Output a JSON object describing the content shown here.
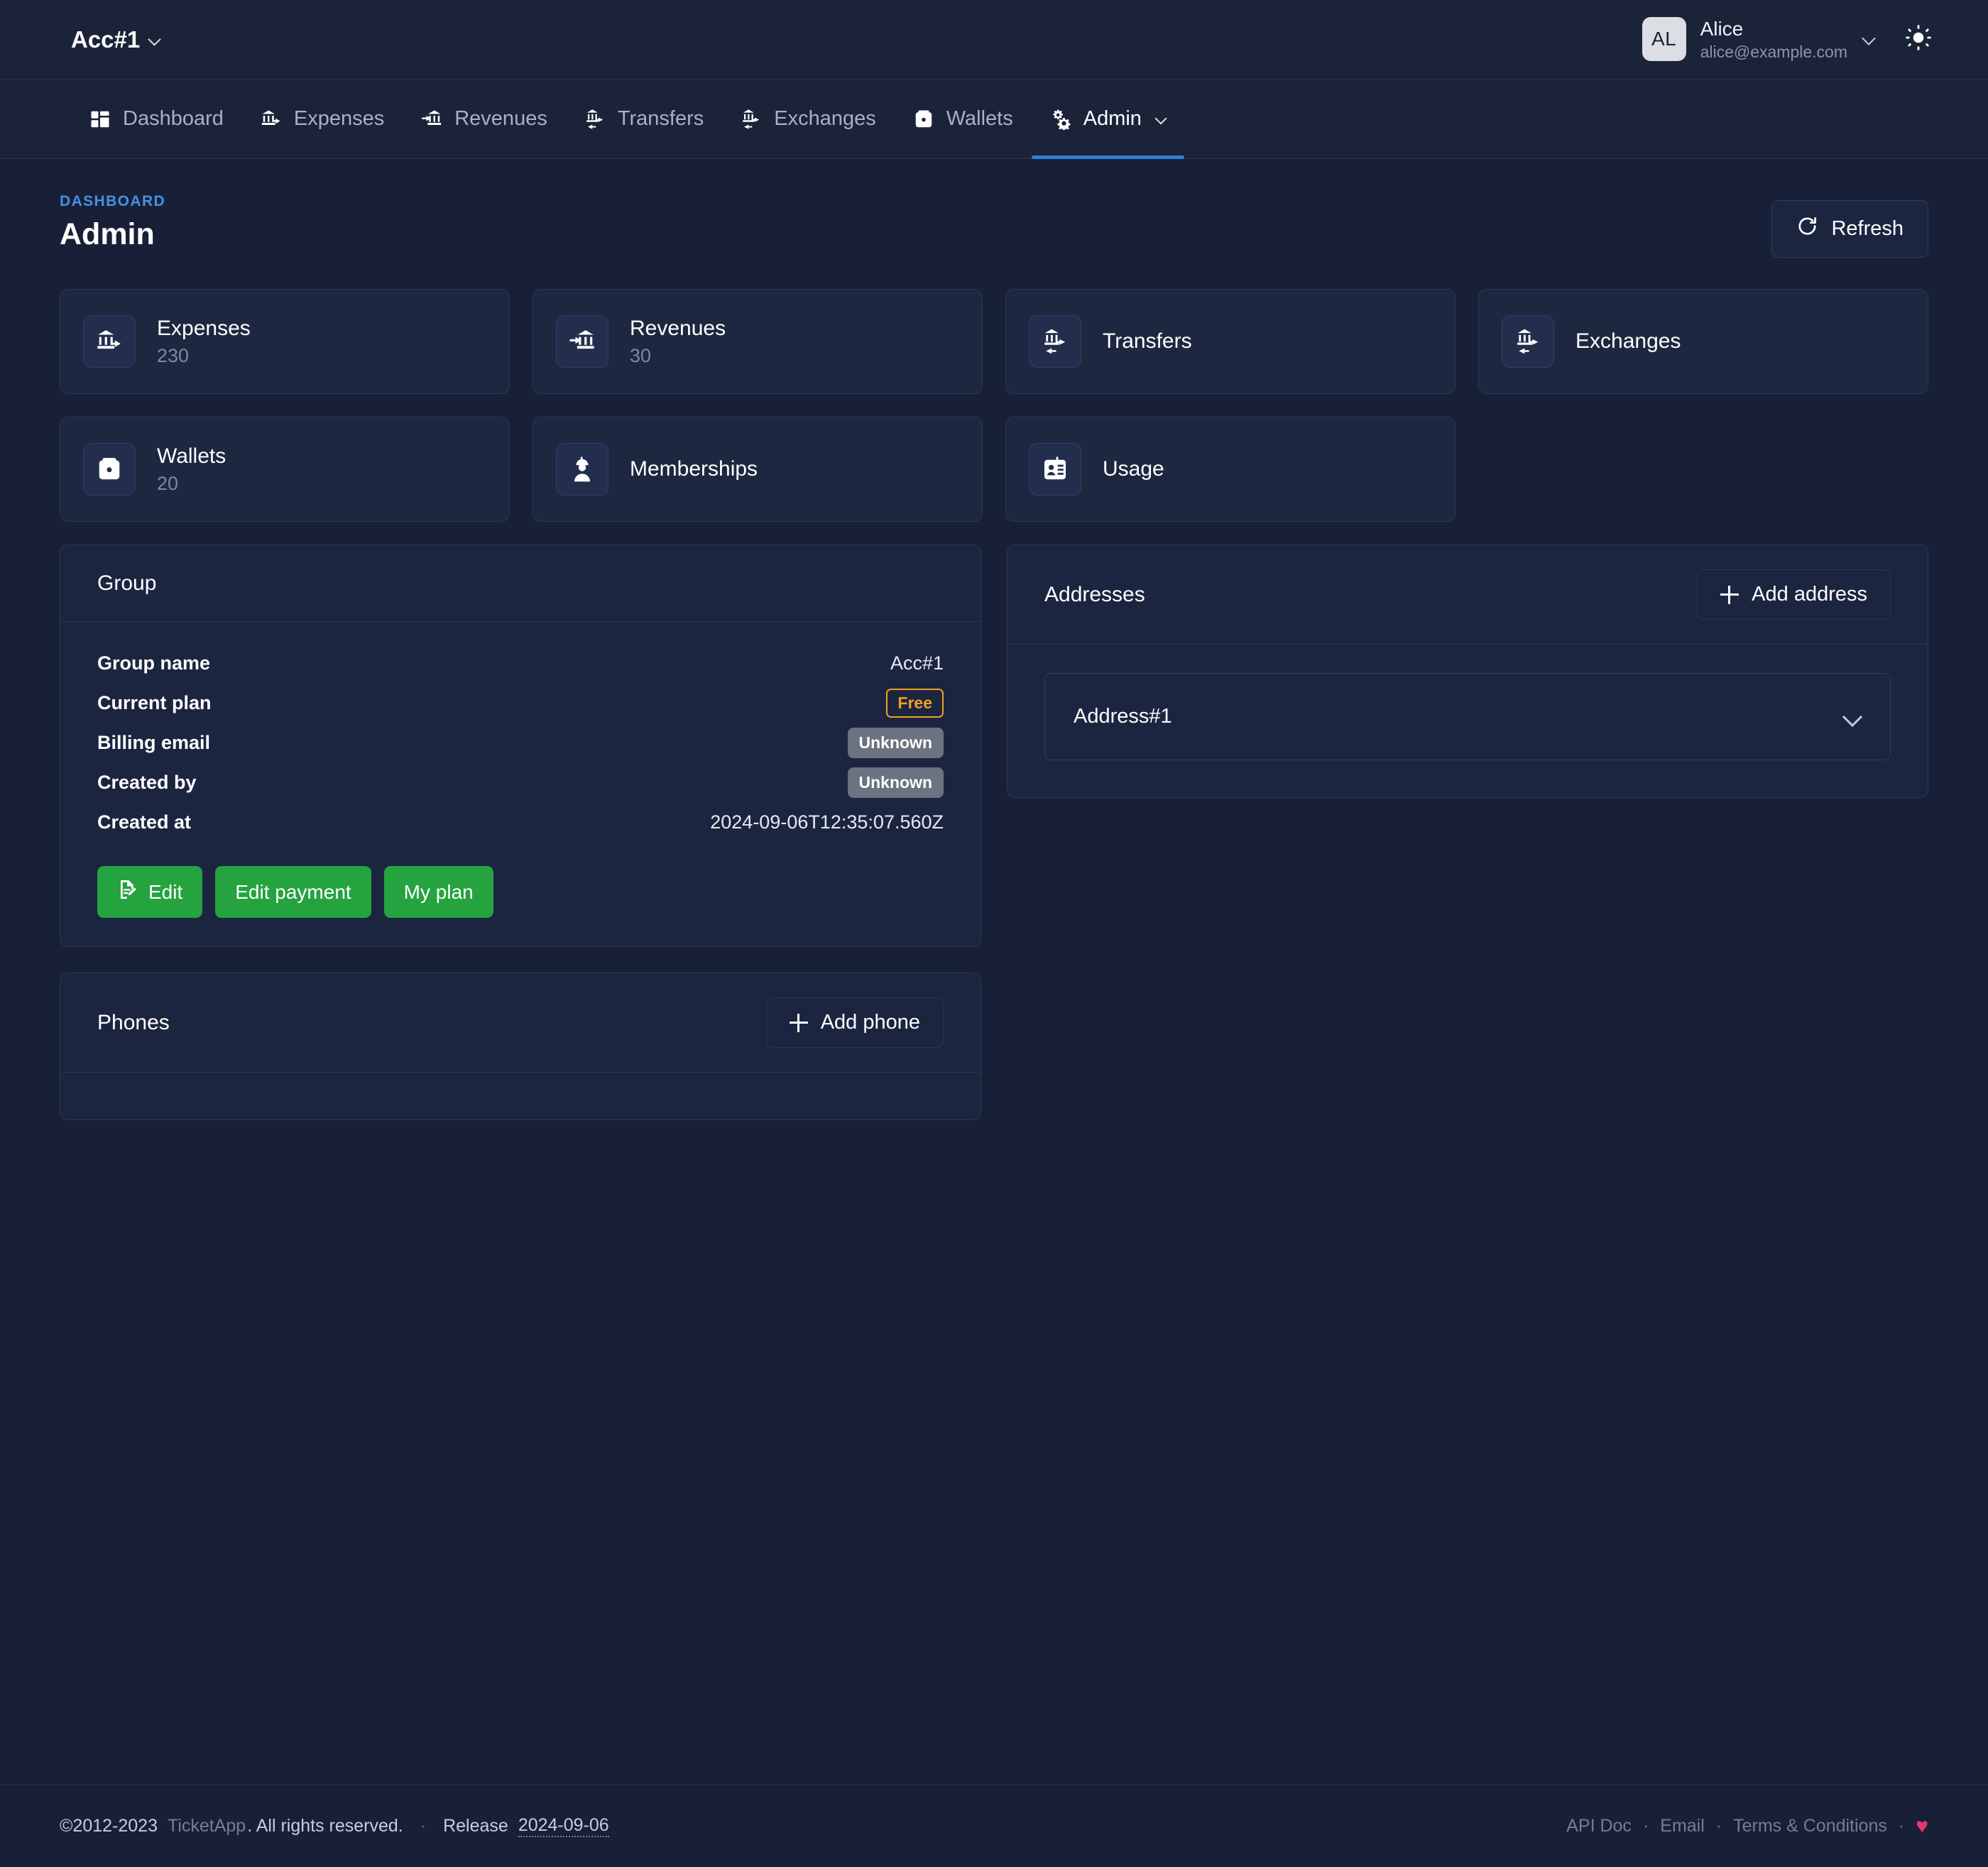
{
  "topbar": {
    "account_name": "Acc#1",
    "user": {
      "initials": "AL",
      "name": "Alice",
      "email": "alice@example.com"
    },
    "theme_toggle_icon": "sun-icon"
  },
  "nav": {
    "items": [
      {
        "label": "Dashboard",
        "icon": "dashboard-icon",
        "active": false,
        "caret": false
      },
      {
        "label": "Expenses",
        "icon": "bank-out-icon",
        "active": false,
        "caret": false
      },
      {
        "label": "Revenues",
        "icon": "bank-in-icon",
        "active": false,
        "caret": false
      },
      {
        "label": "Transfers",
        "icon": "transfer-icon",
        "active": false,
        "caret": false
      },
      {
        "label": "Exchanges",
        "icon": "exchange-icon",
        "active": false,
        "caret": false
      },
      {
        "label": "Wallets",
        "icon": "wallet-icon",
        "active": false,
        "caret": false
      },
      {
        "label": "Admin",
        "icon": "gears-icon",
        "active": true,
        "caret": true
      }
    ]
  },
  "page": {
    "breadcrumb": "DASHBOARD",
    "title": "Admin",
    "refresh_label": "Refresh",
    "refresh_icon": "refresh-icon"
  },
  "stat_cards": [
    {
      "label": "Expenses",
      "count": "230",
      "icon": "bank-out-icon"
    },
    {
      "label": "Revenues",
      "count": "30",
      "icon": "bank-in-icon"
    },
    {
      "label": "Transfers",
      "count": "",
      "icon": "transfer-icon"
    },
    {
      "label": "Exchanges",
      "count": "",
      "icon": "exchange-icon"
    },
    {
      "label": "Wallets",
      "count": "20",
      "icon": "wallet-icon"
    },
    {
      "label": "Memberships",
      "count": "",
      "icon": "member-icon"
    },
    {
      "label": "Usage",
      "count": "",
      "icon": "id-card-icon"
    }
  ],
  "group_panel": {
    "title": "Group",
    "rows": [
      {
        "key": "Group name",
        "value": "Acc#1",
        "type": "text"
      },
      {
        "key": "Current plan",
        "value": "Free",
        "type": "badge-free"
      },
      {
        "key": "Billing email",
        "value": "Unknown",
        "type": "badge-unknown"
      },
      {
        "key": "Created by",
        "value": "Unknown",
        "type": "badge-unknown"
      },
      {
        "key": "Created at",
        "value": "2024-09-06T12:35:07.560Z",
        "type": "text"
      }
    ],
    "buttons": [
      {
        "label": "Edit",
        "icon": "edit-document-icon"
      },
      {
        "label": "Edit payment",
        "icon": ""
      },
      {
        "label": "My plan",
        "icon": ""
      }
    ]
  },
  "phones_panel": {
    "title": "Phones",
    "add_label": "Add phone",
    "items": []
  },
  "addresses_panel": {
    "title": "Addresses",
    "add_label": "Add address",
    "items": [
      {
        "name": "Address#1"
      }
    ]
  },
  "footer": {
    "copyright": "©2012-2023",
    "app_name": "TicketApp",
    "rights": ". All rights reserved.",
    "separator": "·",
    "release_label": "Release",
    "release_date": "2024-09-06",
    "links": [
      "API Doc",
      "Email",
      "Terms & Conditions"
    ],
    "heart": "♥"
  },
  "colors": {
    "page_bg": "#182038",
    "panel_bg": "#1c2540",
    "accent_blue": "#2f7fd4",
    "crumb_blue": "#4a90e2",
    "green": "#24a33f",
    "orange": "#f0a020",
    "gray_badge": "#6b7280",
    "heart_pink": "#e8386a"
  }
}
